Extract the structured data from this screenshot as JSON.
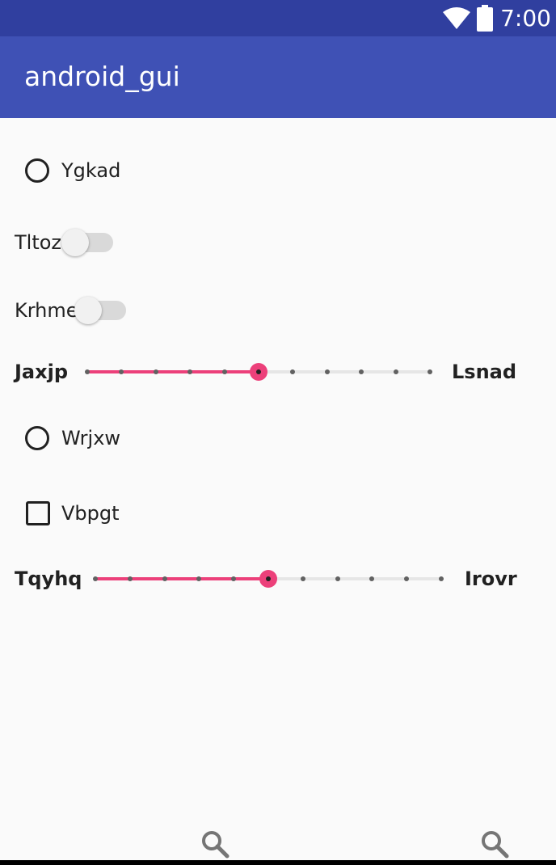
{
  "status_bar": {
    "time": "7:00",
    "icons": [
      "wifi-icon",
      "battery-icon"
    ]
  },
  "app_bar": {
    "title": "android_gui"
  },
  "colors": {
    "status_bar": "#303f9f",
    "app_bar": "#3f51b5",
    "accent": "#ec407a",
    "background": "#fafafa"
  },
  "controls": {
    "radio_1": {
      "label": "Ygkad",
      "checked": false
    },
    "switch_1": {
      "label": "Tltoz",
      "on": false
    },
    "switch_2": {
      "label": "Krhme",
      "on": false
    },
    "seekbar_1": {
      "start_label": "Jaxjp",
      "end_label": "Lsnad",
      "max": 10,
      "value": 5
    },
    "radio_2": {
      "label": "Wrjxw",
      "checked": false
    },
    "checkbox_1": {
      "label": "Vbpgt",
      "checked": false
    },
    "seekbar_2": {
      "start_label": "Tqyhq",
      "end_label": "Irovr",
      "max": 10,
      "value": 5
    }
  },
  "bottom_icons": [
    "search-icon",
    "search-icon"
  ]
}
